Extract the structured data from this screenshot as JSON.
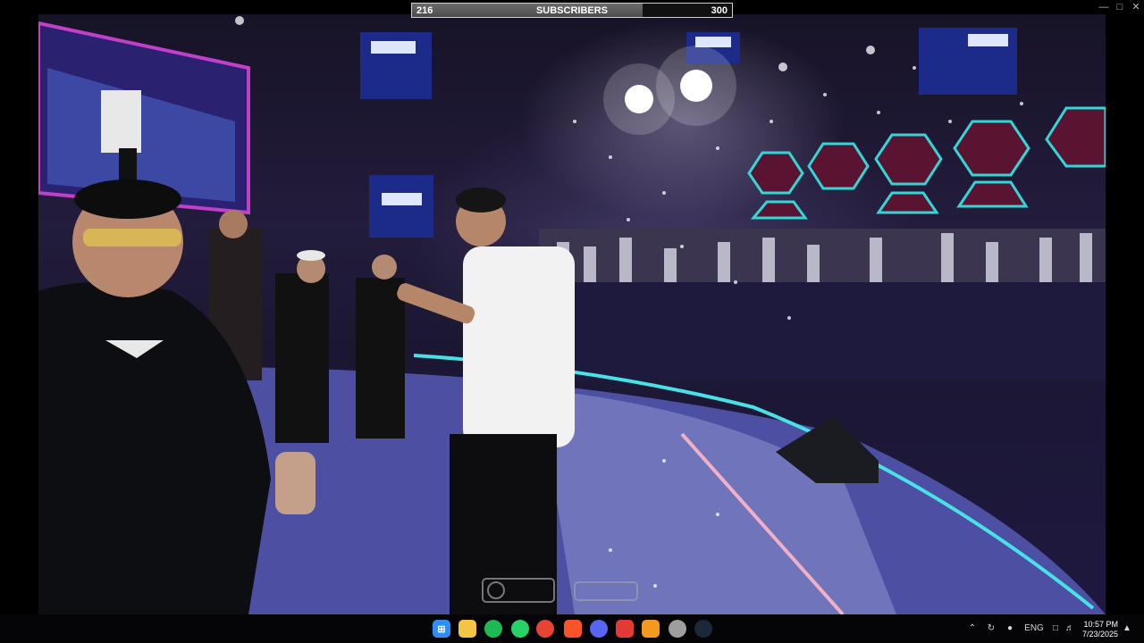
{
  "subscribers": {
    "current": "216",
    "label": "SUBSCRIBERS",
    "goal": "300",
    "progress_fraction": 0.72
  },
  "window_controls": [
    "minimize-icon",
    "maximize-icon",
    "close-icon"
  ],
  "video": {
    "description_icons": [
      "stage-scene"
    ]
  },
  "taskbar": {
    "apps": [
      {
        "name": "windows-start-icon",
        "color": "#2f8ef5"
      },
      {
        "name": "file-explorer-icon",
        "color": "#f4c542"
      },
      {
        "name": "spotify-icon",
        "color": "#1db954"
      },
      {
        "name": "whatsapp-icon",
        "color": "#25d366"
      },
      {
        "name": "chrome-icon",
        "color": "#e84435"
      },
      {
        "name": "brave-icon",
        "color": "#fb542b"
      },
      {
        "name": "discord-icon",
        "color": "#5865f2"
      },
      {
        "name": "red-app-icon",
        "color": "#e53935"
      },
      {
        "name": "orange-app-icon",
        "color": "#f39a1e"
      },
      {
        "name": "gauge-app-icon",
        "color": "#9e9e9e"
      },
      {
        "name": "steam-icon",
        "color": "#1b2838"
      }
    ],
    "tray": {
      "language": "ENG",
      "time": "10:57 PM",
      "date": "7/23/2025"
    }
  }
}
